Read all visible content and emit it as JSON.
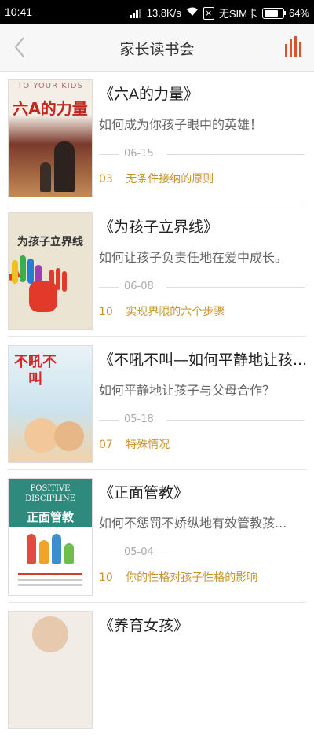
{
  "status_bar": {
    "time": "10:41",
    "speed": "13.8K/s",
    "sim_text": "无SIM卡",
    "battery": "64%"
  },
  "header": {
    "title": "家长读书会",
    "back_icon": "chevron-left-icon",
    "menu_icon": "bar-chart-icon"
  },
  "books": [
    {
      "title": "《六A的力量》",
      "subtitle": "如何成为你孩子眼中的英雄！",
      "date": "06-15",
      "chapter_num": "03",
      "chapter_title": "无条件接纳的原则",
      "cover_text": "六A的力量",
      "cover_top_text": "TO YOUR KIDS"
    },
    {
      "title": "《为孩子立界线》",
      "subtitle": "如何让孩子负责任地在爱中成长。",
      "date": "06-08",
      "chapter_num": "10",
      "chapter_title": "实现界限的六个步骤",
      "cover_text": "为孩子立界线"
    },
    {
      "title": "《不吼不叫—如何平静地让孩...",
      "subtitle": "如何平静地让孩子与父母合作？",
      "date": "05-18",
      "chapter_num": "07",
      "chapter_title": "特殊情况",
      "cover_text": "不吼不叫"
    },
    {
      "title": "《正面管教》",
      "subtitle": "如何不惩罚不娇纵地有效管教孩...",
      "date": "05-04",
      "chapter_num": "10",
      "chapter_title": "你的性格对孩子性格的影响",
      "cover_text": "正面管教",
      "cover_top_text": "POSITIVE DISCIPLINE"
    },
    {
      "title": "《养育女孩》"
    }
  ],
  "colors": {
    "accent": "#e0502c",
    "chapter": "#c8932c"
  }
}
